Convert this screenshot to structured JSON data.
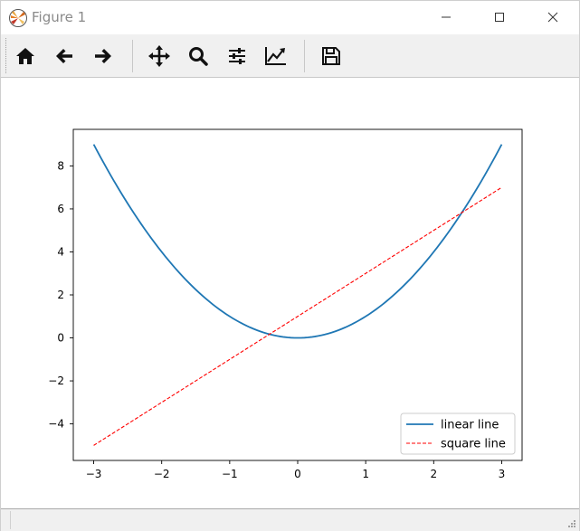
{
  "window": {
    "title": "Figure 1"
  },
  "toolbar": {
    "buttons": [
      {
        "name": "home",
        "icon": "home-icon"
      },
      {
        "name": "back",
        "icon": "arrow-left-icon"
      },
      {
        "name": "forward",
        "icon": "arrow-right-icon"
      },
      {
        "name": "pan",
        "icon": "move-icon"
      },
      {
        "name": "zoom",
        "icon": "magnifier-icon"
      },
      {
        "name": "subplots",
        "icon": "sliders-icon"
      },
      {
        "name": "axes",
        "icon": "line-chart-icon"
      },
      {
        "name": "save",
        "icon": "floppy-disk-icon"
      }
    ]
  },
  "colors": {
    "linear": "#1f77b4",
    "square": "#ff0000",
    "title_text": "#8a8a8a"
  },
  "chart_data": {
    "type": "line",
    "title": "",
    "xlabel": "",
    "ylabel": "",
    "xlim": [
      -3.3,
      3.3
    ],
    "ylim": [
      -5.7,
      9.7
    ],
    "xticks": [
      -3,
      -2,
      -1,
      0,
      1,
      2,
      3
    ],
    "yticks": [
      -4,
      -2,
      0,
      2,
      4,
      6,
      8
    ],
    "xtick_labels": [
      "−3",
      "−2",
      "−1",
      "0",
      "1",
      "2",
      "3"
    ],
    "ytick_labels": [
      "−4",
      "−2",
      "0",
      "2",
      "4",
      "6",
      "8"
    ],
    "grid": false,
    "legend_position": "lower-right",
    "series": [
      {
        "name": "linear line",
        "style": "solid",
        "x": [
          -3,
          -2.5,
          -2,
          -1.5,
          -1,
          -0.5,
          0,
          0.5,
          1,
          1.5,
          2,
          2.5,
          3
        ],
        "y": [
          9,
          6.25,
          4,
          2.25,
          1,
          0.25,
          0,
          0.25,
          1,
          2.25,
          4,
          6.25,
          9
        ]
      },
      {
        "name": "square line",
        "style": "dashed",
        "x": [
          -3,
          3
        ],
        "y": [
          -5,
          7
        ]
      }
    ]
  }
}
